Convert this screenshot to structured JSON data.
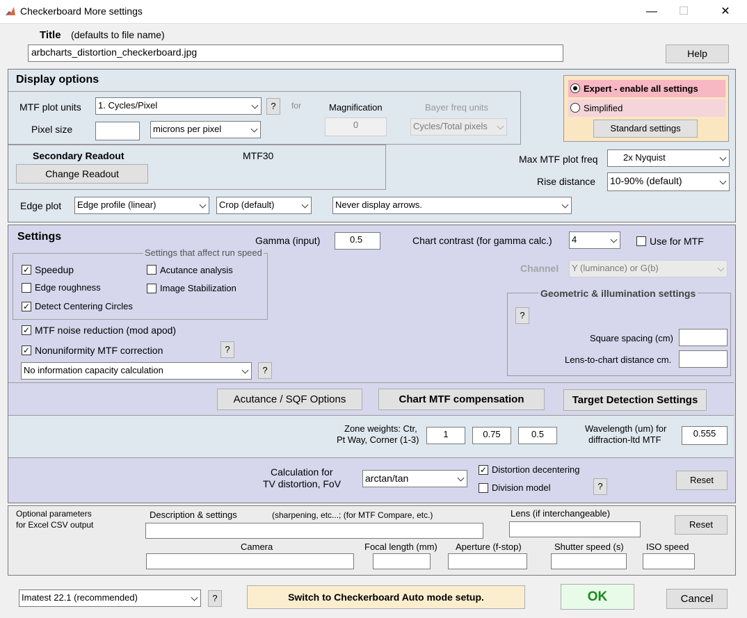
{
  "window": {
    "title": "Checkerboard More settings",
    "min": "—",
    "max": "☐",
    "close": "✕"
  },
  "title_label": "Title",
  "title_hint": "(defaults to file name)",
  "title_value": "arbcharts_distortion_checkerboard.jpg",
  "help": "Help",
  "display": {
    "heading": "Display options",
    "mtf_units_label": "MTF plot units",
    "mtf_units_value": "1. Cycles/Pixel",
    "q": "?",
    "for": "for",
    "magnification_label": "Magnification",
    "magnification_value": "0",
    "bayer_label": "Bayer freq units",
    "bayer_value": "Cycles/Total pixels",
    "pixel_size_label": "Pixel size",
    "pixel_size_value": "",
    "pixel_unit": "microns per pixel",
    "secondary_label": "Secondary Readout",
    "secondary_value": "MTF30",
    "change_readout": "Change Readout",
    "expert": "Expert - enable all settings",
    "simplified": "Simplified",
    "standard": "Standard settings",
    "max_mtf_label": "Max MTF plot freq",
    "max_mtf_value": "2x Nyquist",
    "rise_label": "Rise distance",
    "rise_value": "10-90% (default)",
    "edge_plot_label": "Edge plot",
    "edge_profile": "Edge profile (linear)",
    "crop": "Crop (default)",
    "arrows": "Never display arrows."
  },
  "settings": {
    "heading": "Settings",
    "gamma_label": "Gamma (input)",
    "gamma_value": "0.5",
    "contrast_label": "Chart contrast (for gamma calc.)",
    "contrast_value": "4",
    "use_mtf": "Use for MTF",
    "run_speed_title": "Settings that affect run speed",
    "speedup": "Speedup",
    "acutance": "Acutance analysis",
    "roughness": "Edge roughness",
    "stabilization": "Image Stabilization",
    "centering": "Detect Centering Circles",
    "channel_label": "Channel",
    "channel_value": "Y (luminance) or G(b)",
    "noise_red": "MTF noise reduction (mod  apod)",
    "nonuni": "Nonuniformity MTF correction",
    "info_cap": "No information capacity calculation",
    "geo_title": "Geometric & illumination settings",
    "square_label": "Square spacing (cm)",
    "lens_dist_label": "Lens-to-chart distance cm.",
    "acutance_btn": "Acutance / SQF Options",
    "chart_mtf_btn": "Chart MTF compensation",
    "target_btn": "Target Detection Settings",
    "zone_label1": "Zone weights:  Ctr,",
    "zone_label2": "Pt Way, Corner (1-3)",
    "zone1": "1",
    "zone2": "0.75",
    "zone3": "0.5",
    "wave_label1": "Wavelength (um) for",
    "wave_label2": "diffraction-ltd MTF",
    "wave_value": "0.555",
    "calc_label1": "Calculation for",
    "calc_label2": "TV distortion, FoV",
    "calc_value": "arctan/tan",
    "decenter": "Distortion decentering",
    "division": "Division model",
    "reset": "Reset"
  },
  "optional": {
    "label1": "Optional parameters",
    "label2": "for Excel CSV output",
    "desc_label": "Description & settings",
    "desc_hint": "(sharpening, etc...; (for MTF Compare, etc.)",
    "lens_label": "Lens (if interchangeable)",
    "reset": "Reset",
    "camera": "Camera",
    "focal": "Focal length (mm)",
    "aperture": "Aperture (f-stop)",
    "shutter": "Shutter speed (s)",
    "iso": "ISO speed"
  },
  "bottom": {
    "version": "Imatest 22.1 (recommended)",
    "switch": "Switch to Checkerboard Auto mode setup.",
    "ok": "OK",
    "cancel": "Cancel"
  },
  "colors": {
    "expert_bg": "#f7b7c3",
    "mode_panel_bg": "#fbe6c2",
    "ok_bg": "#e8fbe8",
    "switch_bg": "#fbeecf"
  }
}
